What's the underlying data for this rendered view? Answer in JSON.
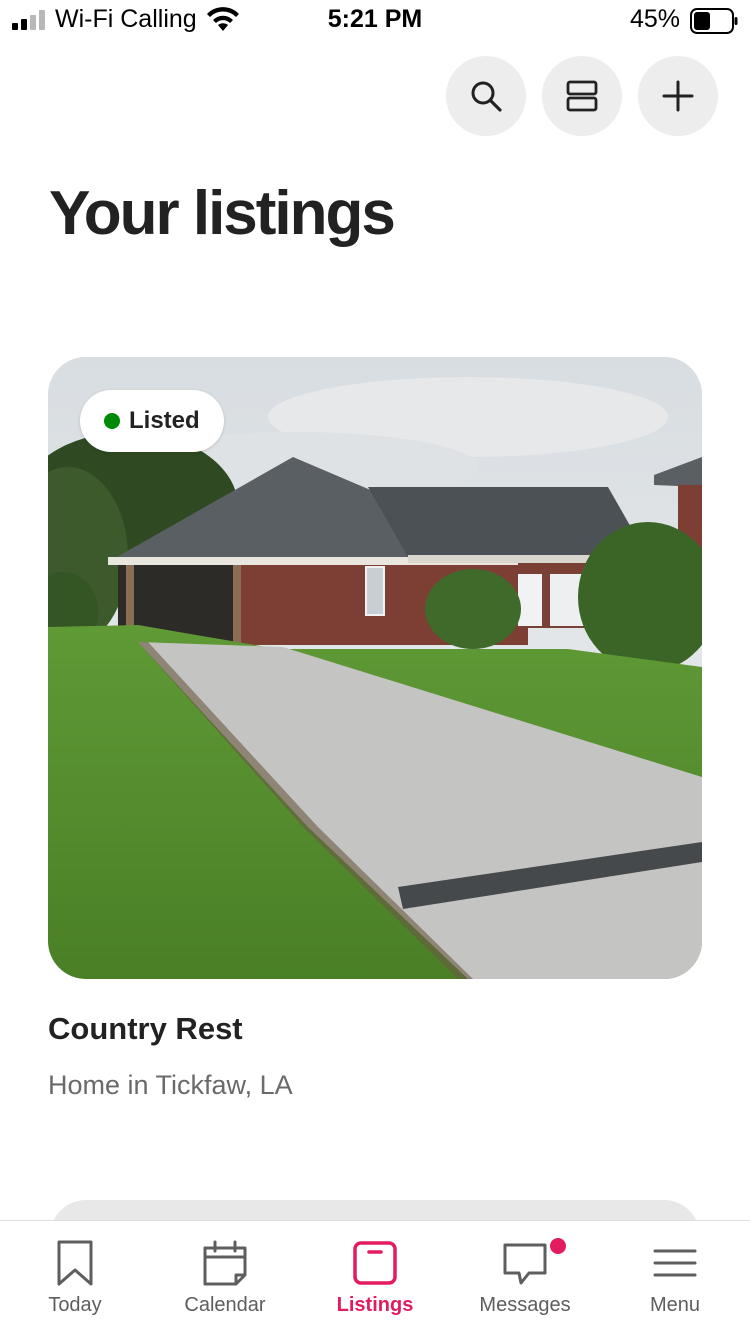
{
  "status_bar": {
    "carrier": "Wi-Fi Calling",
    "time": "5:21 PM",
    "battery_percent": "45%",
    "battery_level": 0.45
  },
  "top_actions": [
    {
      "icon": "search-icon"
    },
    {
      "icon": "layout-toggle-icon"
    },
    {
      "icon": "plus-icon"
    }
  ],
  "page": {
    "title": "Your listings"
  },
  "listing": {
    "status": "Listed",
    "status_color": "#008a05",
    "name": "Country Rest",
    "subtitle": "Home in Tickfaw, LA"
  },
  "tabs": [
    {
      "label": "Today",
      "icon": "bookmark-icon",
      "active": false
    },
    {
      "label": "Calendar",
      "icon": "calendar-icon",
      "active": false
    },
    {
      "label": "Listings",
      "icon": "listings-icon",
      "active": true
    },
    {
      "label": "Messages",
      "icon": "message-icon",
      "active": false,
      "badge": true
    },
    {
      "label": "Menu",
      "icon": "menu-icon",
      "active": false
    }
  ],
  "colors": {
    "accent": "#e31c5f",
    "text_primary": "#222222",
    "text_secondary": "#6a6a6a"
  }
}
